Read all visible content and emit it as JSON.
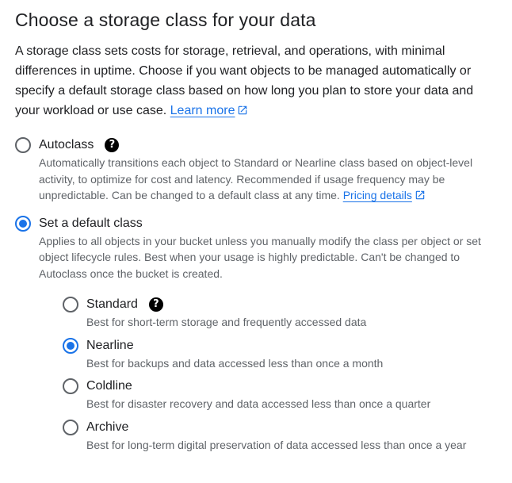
{
  "heading": "Choose a storage class for your data",
  "intro": {
    "text": "A storage class sets costs for storage, retrieval, and operations, with minimal differences in uptime. Choose if you want objects to be managed automatically or specify a default storage class based on how long you plan to store your data and your workload or use case.",
    "learn_more": "Learn more"
  },
  "options": {
    "autoclass": {
      "label": "Autoclass",
      "selected": false,
      "description": "Automatically transitions each object to Standard or Nearline class based on object-level activity, to optimize for cost and latency. Recommended if usage frequency may be unpredictable. Can be changed to a default class at any time.",
      "pricing_link": "Pricing details"
    },
    "default_class": {
      "label": "Set a default class",
      "selected": true,
      "description": "Applies to all objects in your bucket unless you manually modify the class per object or set object lifecycle rules. Best when your usage is highly predictable. Can't be changed to Autoclass once the bucket is created."
    }
  },
  "classes": [
    {
      "label": "Standard",
      "description": "Best for short-term storage and frequently accessed data",
      "selected": false
    },
    {
      "label": "Nearline",
      "description": "Best for backups and data accessed less than once a month",
      "selected": true
    },
    {
      "label": "Coldline",
      "description": "Best for disaster recovery and data accessed less than once a quarter",
      "selected": false
    },
    {
      "label": "Archive",
      "description": "Best for long-term digital preservation of data accessed less than once a year",
      "selected": false
    }
  ],
  "icons": {
    "help": "help-icon",
    "external": "open-in-new-icon",
    "help_glyph": "?"
  },
  "colors": {
    "accent": "#1a73e8",
    "text": "#202124",
    "secondary_text": "#5f6368"
  }
}
